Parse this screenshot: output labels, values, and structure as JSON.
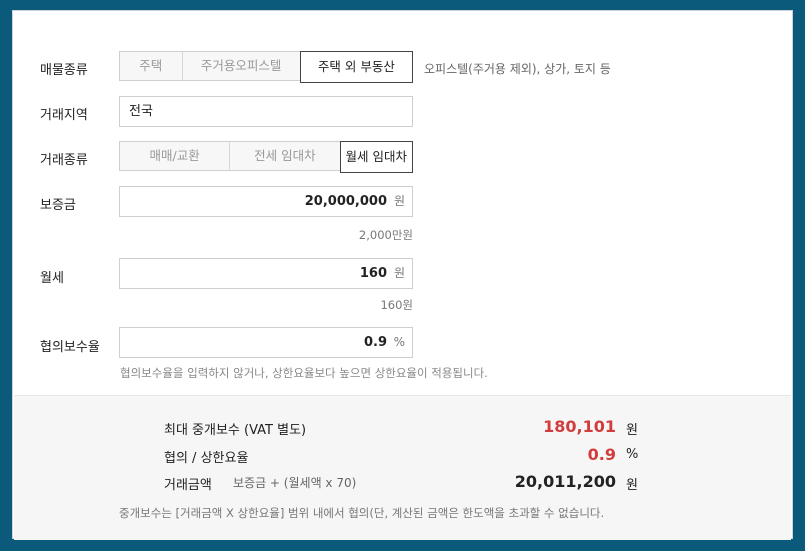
{
  "property_type": {
    "label": "매물종류",
    "options": [
      "주택",
      "주거용오피스텔",
      "주택 외 부동산"
    ],
    "selected": "주택 외 부동산",
    "hint": "오피스텔(주거용 제외), 상가, 토지 등"
  },
  "region": {
    "label": "거래지역",
    "value": "전국"
  },
  "deal_type": {
    "label": "거래종류",
    "options": [
      "매매/교환",
      "전세 임대차",
      "월세 임대차"
    ],
    "selected": "월세 임대차"
  },
  "deposit": {
    "label": "보증금",
    "value": "20,000,000",
    "unit": "원",
    "sub": "2,000만원"
  },
  "monthly_rent": {
    "label": "월세",
    "value": "160",
    "unit": "원",
    "sub": "160원"
  },
  "fee_rate": {
    "label": "협의보수율",
    "value": "0.9",
    "unit": "%",
    "note": "협의보수율을 입력하지 않거나, 상한요율보다 높으면 상한요율이 적용됩니다."
  },
  "result": {
    "max_fee_label": "최대 중개보수 (VAT 별도)",
    "max_fee_value": "180,101",
    "max_fee_unit": "원",
    "rate_label": "협의 / 상한요율",
    "rate_value": "0.9",
    "rate_unit": "%",
    "amount_label": "거래금액",
    "amount_formula": "보증금 + (월세액 x 70)",
    "amount_value": "20,011,200",
    "amount_unit": "원",
    "footnote": "중개보수는 [거래금액 X 상한요율] 범위 내에서 협의(단, 계산된 금액은 한도액을 초과할 수 없습니다."
  },
  "colors": {
    "accent_red": "#d23c3c",
    "background": "#0b5a7c"
  }
}
